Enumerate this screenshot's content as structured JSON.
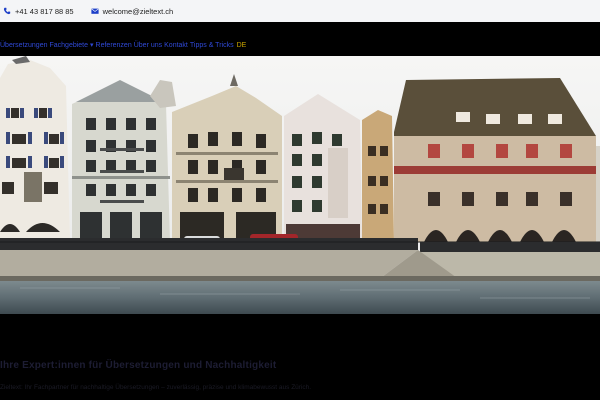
{
  "contact": {
    "phone": "+41 43 817 88 85",
    "email": "welcome@zieltext.ch"
  },
  "nav": {
    "items": [
      "Übersetzungen",
      "Fachgebiete",
      "Referenzen",
      "Über uns",
      "Kontakt",
      "Tipps & Tricks"
    ],
    "language": "DE"
  },
  "content": {
    "headline": "Ihre Expert:innen für Übersetzungen und Nachhaltigkeit",
    "description": "Zieltext: Ihr Fachpartner für nachhaltige Übersetzungen – zuverlässig, präzise und klimabewusst aus Zürich."
  },
  "colors": {
    "topbar_bg": "#f4f5f7",
    "nav_link": "#2f49d6",
    "language": "#c9a400",
    "page_bg": "#000000"
  },
  "icons": [
    "phone-icon",
    "mail-icon"
  ]
}
